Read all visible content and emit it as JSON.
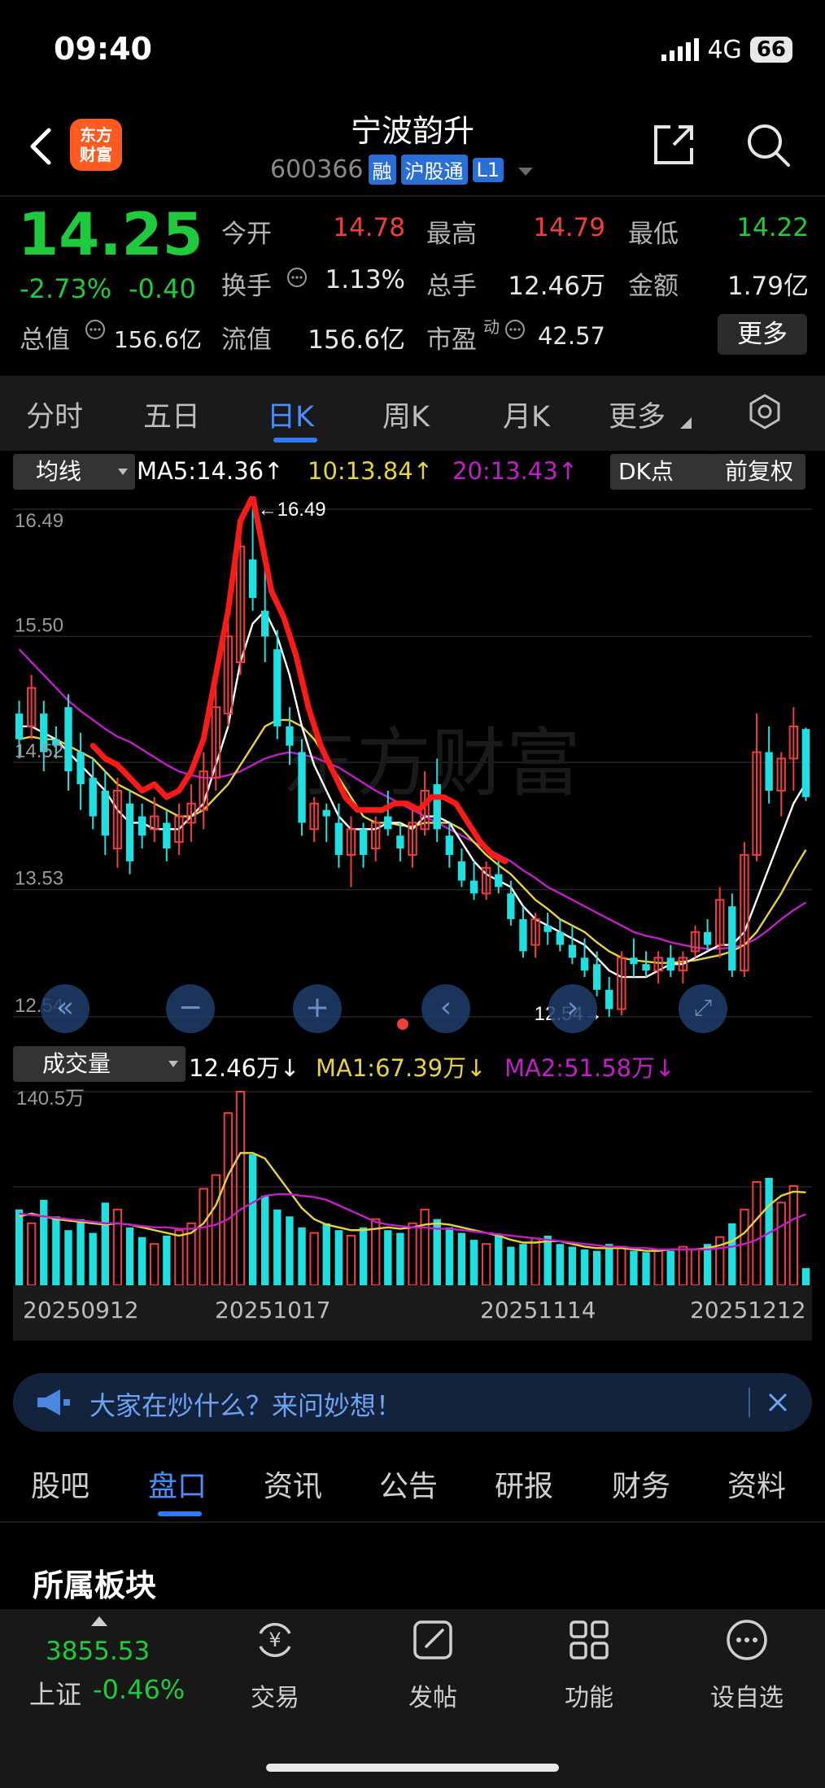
{
  "status": {
    "time": "09:40",
    "network": "4G",
    "battery": "66"
  },
  "header": {
    "logo_line1": "东方",
    "logo_line2": "财富",
    "stock_name": "宁波韵升",
    "stock_code": "600366",
    "tags": [
      "融",
      "沪股通",
      "L1"
    ]
  },
  "quote": {
    "price": "14.25",
    "change_pct": "-2.73%",
    "change": "-0.40",
    "open_label": "今开",
    "open": "14.78",
    "high_label": "最高",
    "high": "14.79",
    "low_label": "最低",
    "low": "14.22",
    "turnover_label": "换手",
    "turnover": "1.13%",
    "volume_label": "总手",
    "volume": "12.46万",
    "amount_label": "金额",
    "amount": "1.79亿",
    "total_cap_label": "总值",
    "total_cap": "156.6亿",
    "float_cap_label": "流值",
    "float_cap": "156.6亿",
    "pe_label": "市盈",
    "pe_sup": "动",
    "pe": "42.57",
    "more_button": "更多"
  },
  "period_tabs": [
    "分时",
    "五日",
    "日K",
    "周K",
    "月K",
    "更多"
  ],
  "active_period": "日K",
  "ma_bar": {
    "selector": "均线",
    "ma5": "MA5:14.36",
    "ma10": "10:13.84",
    "ma20": "20:13.43",
    "dk": "DK点",
    "adjust": "前复权"
  },
  "kline_axis": {
    "y_labels": [
      "16.49",
      "15.50",
      "14.52",
      "13.53",
      "12.54"
    ],
    "high_mark": "16.49",
    "low_mark": "12.54"
  },
  "watermark": "东方财富",
  "volume_bar": {
    "selector": "成交量",
    "vol": "12.46万",
    "ma1": "MA1:67.39万",
    "ma2": "MA2:51.58万",
    "y_max": "140.5万"
  },
  "x_dates": [
    "20250912",
    "20251017",
    "20251114",
    "20251212"
  ],
  "banner": {
    "text": "大家在炒什么？来问妙想！"
  },
  "info_tabs": [
    "股吧",
    "盘口",
    "资讯",
    "公告",
    "研报",
    "财务",
    "资料"
  ],
  "active_info_tab": "盘口",
  "section_title": "所属板块",
  "bottom": {
    "index_value": "3855.53",
    "index_name": "上证",
    "index_change": "-0.46%",
    "items": [
      "交易",
      "发帖",
      "功能",
      "设自选"
    ]
  },
  "colors": {
    "up": "#f23d3d",
    "down": "#1fe0e0",
    "price_green": "#1fcb3c",
    "ma5": "#ffffff",
    "ma10": "#e6d43a",
    "ma20": "#c21fc8",
    "accent": "#2f7cf6"
  },
  "chart_data": {
    "type": "candlestick",
    "ylim": [
      12.54,
      16.49
    ],
    "y_ticks": [
      16.49,
      15.5,
      14.52,
      13.53,
      12.54
    ],
    "candles": [
      [
        14.9,
        15.0,
        14.55,
        14.7
      ],
      [
        14.8,
        15.2,
        14.7,
        15.1
      ],
      [
        14.9,
        15.0,
        14.45,
        14.6
      ],
      [
        14.7,
        14.8,
        14.55,
        14.65
      ],
      [
        14.95,
        15.05,
        14.3,
        14.45
      ],
      [
        14.6,
        14.75,
        14.15,
        14.35
      ],
      [
        14.4,
        14.55,
        14.0,
        14.1
      ],
      [
        14.3,
        14.45,
        13.8,
        13.95
      ],
      [
        13.85,
        14.4,
        13.7,
        14.3
      ],
      [
        14.2,
        14.3,
        13.65,
        13.75
      ],
      [
        14.1,
        14.2,
        13.85,
        13.95
      ],
      [
        14.0,
        14.25,
        13.9,
        14.1
      ],
      [
        14.05,
        14.15,
        13.75,
        13.85
      ],
      [
        13.9,
        14.2,
        13.8,
        14.1
      ],
      [
        14.05,
        14.35,
        13.9,
        14.2
      ],
      [
        14.15,
        14.6,
        14.0,
        14.45
      ],
      [
        14.4,
        15.1,
        14.3,
        14.95
      ],
      [
        14.9,
        15.6,
        14.8,
        15.5
      ],
      [
        15.3,
        16.3,
        15.2,
        16.2
      ],
      [
        16.1,
        16.49,
        15.7,
        15.8
      ],
      [
        15.7,
        16.1,
        15.3,
        15.5
      ],
      [
        15.4,
        15.55,
        14.7,
        14.8
      ],
      [
        14.8,
        14.95,
        14.5,
        14.65
      ],
      [
        14.6,
        14.7,
        13.95,
        14.05
      ],
      [
        14.0,
        14.25,
        13.9,
        14.2
      ],
      [
        14.15,
        14.2,
        13.9,
        14.1
      ],
      [
        14.05,
        14.2,
        13.7,
        13.8
      ],
      [
        13.8,
        14.1,
        13.55,
        14.0
      ],
      [
        14.0,
        14.05,
        13.7,
        13.8
      ],
      [
        13.85,
        14.1,
        13.75,
        14.05
      ],
      [
        14.1,
        14.3,
        13.95,
        14.0
      ],
      [
        13.95,
        14.05,
        13.75,
        13.85
      ],
      [
        13.8,
        14.15,
        13.7,
        14.05
      ],
      [
        14.0,
        14.45,
        13.95,
        14.3
      ],
      [
        14.35,
        14.55,
        13.9,
        14.0
      ],
      [
        13.95,
        14.05,
        13.7,
        13.8
      ],
      [
        13.75,
        13.85,
        13.55,
        13.6
      ],
      [
        13.6,
        13.75,
        13.45,
        13.5
      ],
      [
        13.5,
        13.75,
        13.45,
        13.7
      ],
      [
        13.65,
        13.8,
        13.5,
        13.55
      ],
      [
        13.5,
        13.6,
        13.25,
        13.3
      ],
      [
        13.3,
        13.4,
        13.0,
        13.05
      ],
      [
        13.1,
        13.35,
        13.0,
        13.3
      ],
      [
        13.25,
        13.35,
        13.1,
        13.2
      ],
      [
        13.2,
        13.3,
        13.05,
        13.1
      ],
      [
        13.1,
        13.25,
        12.95,
        13.0
      ],
      [
        13.0,
        13.15,
        12.85,
        12.9
      ],
      [
        12.95,
        13.05,
        12.7,
        12.75
      ],
      [
        12.75,
        12.85,
        12.54,
        12.6
      ],
      [
        12.6,
        13.05,
        12.55,
        13.0
      ],
      [
        13.0,
        13.15,
        12.85,
        12.95
      ],
      [
        12.95,
        13.05,
        12.85,
        12.9
      ],
      [
        12.9,
        13.05,
        12.8,
        13.0
      ],
      [
        13.0,
        13.1,
        12.85,
        12.9
      ],
      [
        12.9,
        13.05,
        12.8,
        13.0
      ],
      [
        13.05,
        13.25,
        13.0,
        13.2
      ],
      [
        13.2,
        13.3,
        13.05,
        13.1
      ],
      [
        13.1,
        13.55,
        13.0,
        13.45
      ],
      [
        13.4,
        13.5,
        12.85,
        12.9
      ],
      [
        12.9,
        13.9,
        12.85,
        13.8
      ],
      [
        13.8,
        14.9,
        13.75,
        14.6
      ],
      [
        14.6,
        14.8,
        14.2,
        14.3
      ],
      [
        14.3,
        14.6,
        14.1,
        14.55
      ],
      [
        14.55,
        14.95,
        14.3,
        14.8
      ],
      [
        14.78,
        14.79,
        14.22,
        14.25
      ]
    ],
    "volumes": [
      55,
      45,
      62,
      50,
      40,
      48,
      38,
      60,
      55,
      42,
      35,
      30,
      36,
      40,
      45,
      70,
      80,
      125,
      140.5,
      95,
      65,
      55,
      50,
      42,
      38,
      45,
      40,
      36,
      42,
      48,
      40,
      38,
      45,
      55,
      48,
      42,
      38,
      33,
      30,
      36,
      28,
      30,
      34,
      36,
      30,
      28,
      26,
      25,
      30,
      28,
      25,
      24,
      26,
      25,
      28,
      26,
      30,
      35,
      45,
      55,
      75,
      78,
      60,
      72,
      12.46
    ],
    "ma5_line": [
      14.8,
      14.8,
      14.75,
      14.7,
      14.6,
      14.5,
      14.4,
      14.3,
      14.15,
      14.05,
      14.05,
      14.0,
      14.0,
      14.0,
      14.1,
      14.2,
      14.5,
      14.8,
      15.3,
      15.6,
      15.7,
      15.5,
      15.2,
      14.8,
      14.5,
      14.3,
      14.1,
      14.0,
      14.0,
      14.0,
      14.05,
      14.05,
      14.0,
      14.1,
      14.1,
      14.05,
      13.9,
      13.75,
      13.65,
      13.6,
      13.55,
      13.4,
      13.3,
      13.25,
      13.2,
      13.15,
      13.1,
      13.0,
      12.9,
      12.85,
      12.85,
      12.85,
      12.9,
      12.95,
      12.95,
      13.0,
      13.05,
      13.1,
      13.1,
      13.2,
      13.45,
      13.7,
      13.95,
      14.2,
      14.36
    ],
    "ma10_line": [
      14.7,
      14.72,
      14.7,
      14.7,
      14.65,
      14.6,
      14.55,
      14.45,
      14.35,
      14.3,
      14.25,
      14.2,
      14.15,
      14.1,
      14.1,
      14.15,
      14.25,
      14.35,
      14.5,
      14.65,
      14.8,
      14.85,
      14.85,
      14.8,
      14.7,
      14.55,
      14.4,
      14.25,
      14.1,
      14.05,
      14.05,
      14.03,
      14.02,
      14.05,
      14.05,
      14.05,
      14.0,
      13.9,
      13.8,
      13.72,
      13.65,
      13.55,
      13.45,
      13.38,
      13.3,
      13.25,
      13.2,
      13.12,
      13.05,
      13.0,
      12.98,
      12.97,
      12.96,
      12.96,
      12.97,
      12.98,
      13.0,
      13.02,
      13.05,
      13.1,
      13.2,
      13.35,
      13.5,
      13.68,
      13.84
    ],
    "ma20_line": [
      15.4,
      15.3,
      15.2,
      15.1,
      15.0,
      14.92,
      14.85,
      14.78,
      14.72,
      14.68,
      14.62,
      14.56,
      14.5,
      14.45,
      14.42,
      14.4,
      14.4,
      14.42,
      14.45,
      14.5,
      14.55,
      14.58,
      14.6,
      14.58,
      14.56,
      14.52,
      14.48,
      14.42,
      14.36,
      14.3,
      14.25,
      14.2,
      14.15,
      14.1,
      14.05,
      14.0,
      13.95,
      13.9,
      13.85,
      13.8,
      13.75,
      13.68,
      13.62,
      13.55,
      13.5,
      13.45,
      13.4,
      13.35,
      13.3,
      13.25,
      13.2,
      13.17,
      13.15,
      13.12,
      13.1,
      13.08,
      13.07,
      13.07,
      13.08,
      13.1,
      13.15,
      13.22,
      13.3,
      13.37,
      13.43
    ],
    "vol_ma1": [
      50,
      52,
      50,
      48,
      47,
      46,
      45,
      44,
      45,
      44,
      42,
      40,
      38,
      36,
      38,
      45,
      58,
      80,
      96,
      96,
      92,
      80,
      68,
      56,
      48,
      44,
      42,
      40,
      40,
      41,
      42,
      41,
      42,
      44,
      45,
      44,
      42,
      40,
      38,
      36,
      33,
      31,
      31,
      32,
      32,
      30,
      28,
      27,
      27,
      27,
      26,
      25,
      25,
      26,
      26,
      26,
      27,
      29,
      32,
      38,
      48,
      58,
      65,
      68,
      67.39
    ],
    "vol_ma2": [
      52,
      51,
      50,
      49,
      48,
      47,
      46,
      45,
      45,
      44,
      43,
      42,
      42,
      41,
      41,
      42,
      44,
      48,
      55,
      60,
      65,
      66,
      66,
      65,
      64,
      62,
      58,
      54,
      50,
      46,
      44,
      43,
      42,
      42,
      41,
      41,
      40,
      39,
      38,
      37,
      36,
      35,
      34,
      33,
      32,
      31,
      30,
      29,
      28,
      28,
      27,
      27,
      26,
      26,
      26,
      26,
      26,
      27,
      28,
      30,
      33,
      38,
      43,
      48,
      51.58
    ],
    "hand_drawn_annotation": "red freehand stroke marking a rise then decline"
  }
}
